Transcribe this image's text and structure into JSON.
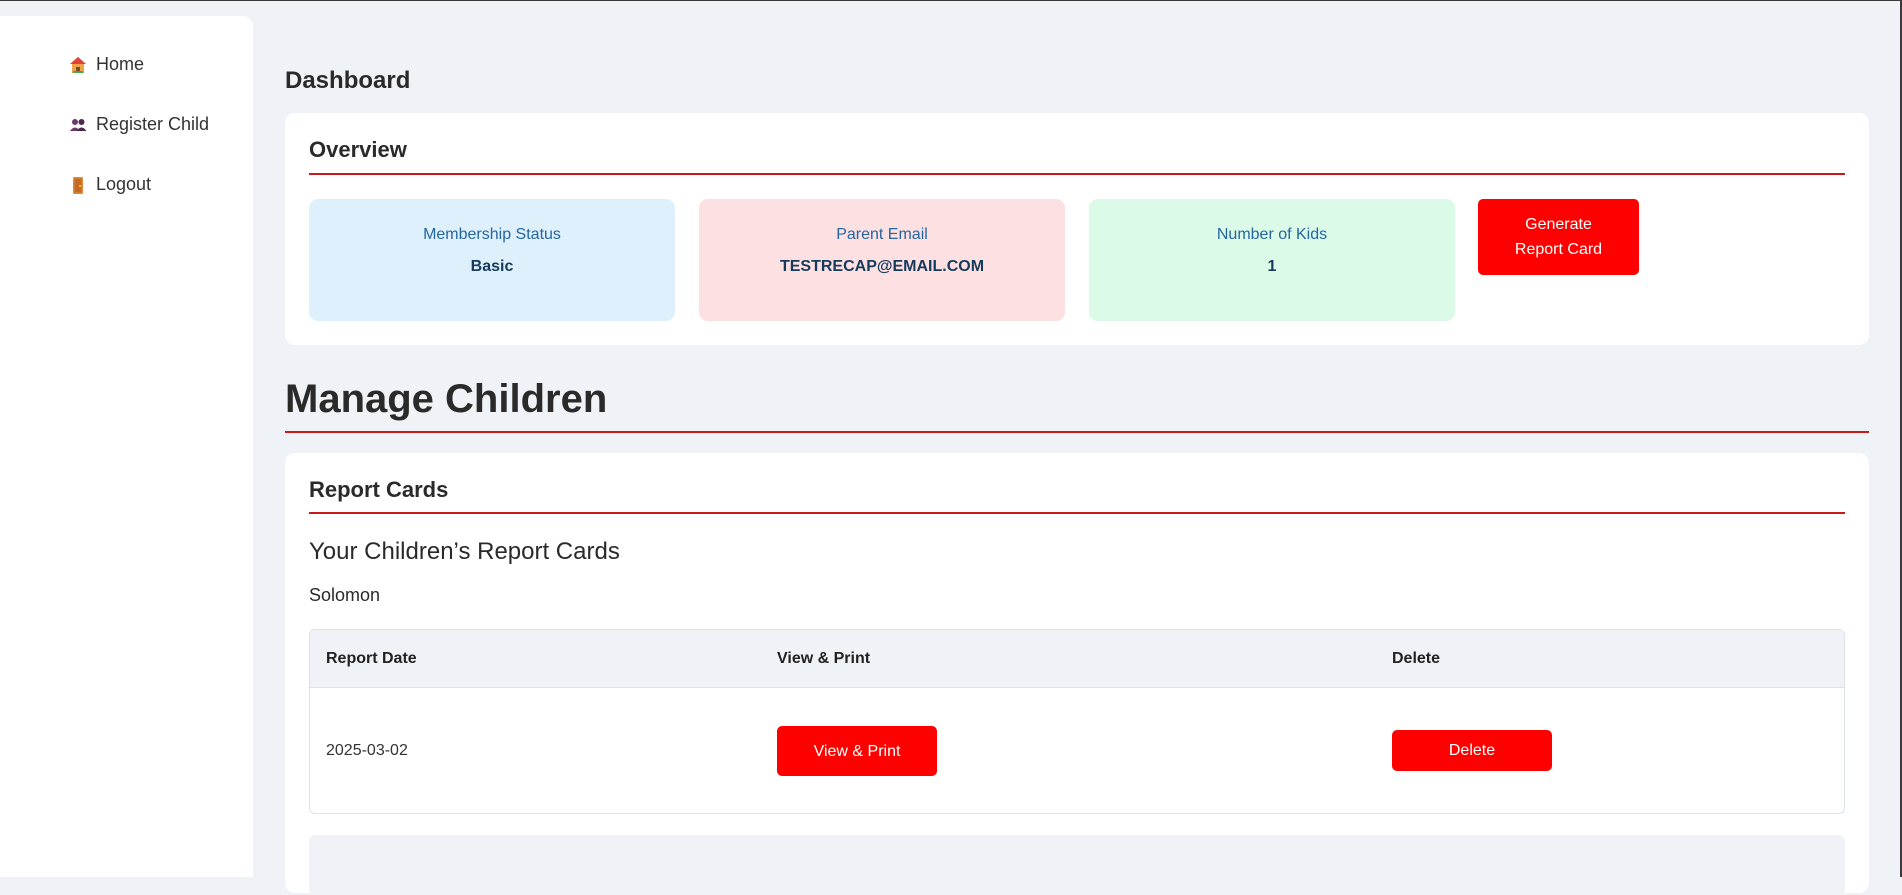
{
  "sidebar": {
    "items": [
      {
        "label": "Home",
        "icon": "house-icon"
      },
      {
        "label": "Register Child",
        "icon": "users-icon"
      },
      {
        "label": "Logout",
        "icon": "door-icon"
      }
    ]
  },
  "page": {
    "title": "Dashboard"
  },
  "overview": {
    "title": "Overview",
    "stats": [
      {
        "label": "Membership Status",
        "value": "Basic",
        "bg": "#ddf0fc"
      },
      {
        "label": "Parent Email",
        "value": "TESTRECAP@EMAIL.COM",
        "bg": "#fde0e2"
      },
      {
        "label": "Number of Kids",
        "value": "1",
        "bg": "#dbfbe8"
      }
    ],
    "generate_button": "Generate Report Card"
  },
  "manage": {
    "title": "Manage Children"
  },
  "report_cards": {
    "title": "Report Cards",
    "subtitle": "Your Children’s Report Cards",
    "child_name": "Solomon",
    "columns": [
      "Report Date",
      "View & Print",
      "Delete"
    ],
    "rows": [
      {
        "date": "2025-03-02",
        "view_label": "View & Print",
        "delete_label": "Delete"
      }
    ]
  },
  "colors": {
    "accent": "#ff0000",
    "rule": "#c91a1a",
    "background": "#eff2f7"
  }
}
